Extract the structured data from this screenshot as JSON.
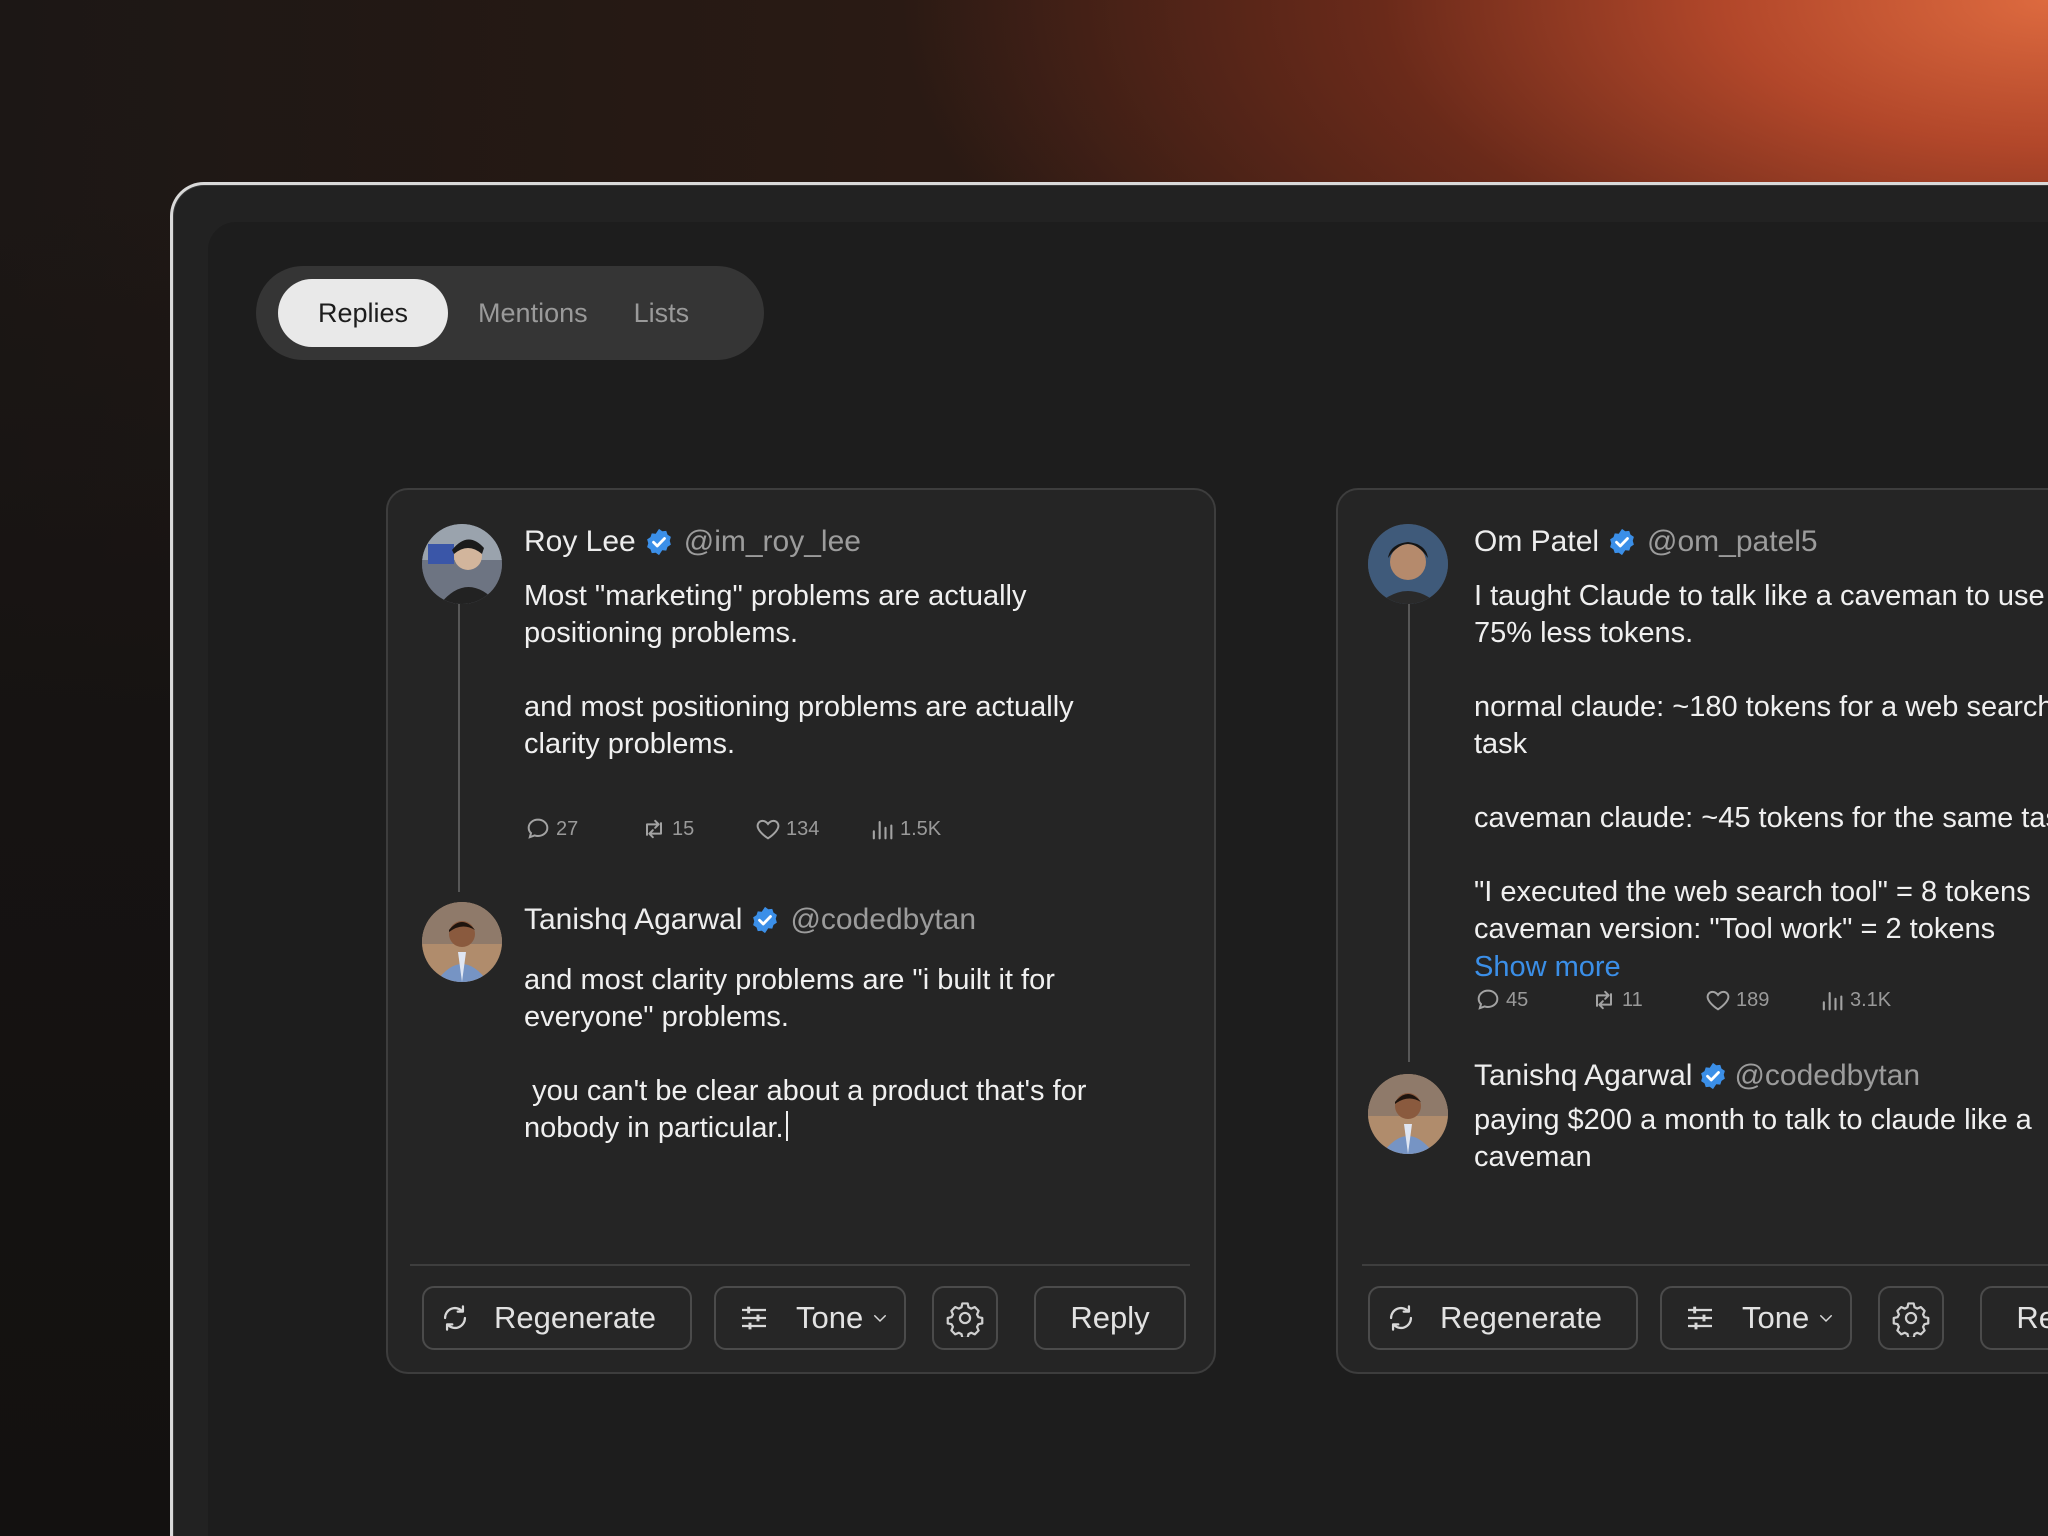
{
  "tabs": [
    "Replies",
    "Mentions",
    "Lists"
  ],
  "active_tab": "Replies",
  "cards": [
    {
      "original": {
        "name": "Roy Lee",
        "handle": "@im_roy_lee",
        "text": "Most \"marketing\" problems are actually\npositioning problems.\n\nand most positioning problems are actually\nclarity problems.",
        "stats": {
          "replies": "27",
          "reposts": "15",
          "likes": "134",
          "views": "1.5K"
        }
      },
      "reply": {
        "name": "Tanishq Agarwal",
        "handle": "@codedbytan",
        "text": "and most clarity problems are \"i built it for\neveryone\" problems.\n\n you can't be clear about a product that's for\nnobody in particular."
      },
      "actions": {
        "regenerate": "Regenerate",
        "tone": "Tone",
        "reply": "Reply"
      }
    },
    {
      "original": {
        "name": "Om Patel",
        "handle": "@om_patel5",
        "text": "I taught Claude to talk like a caveman to use\n75% less tokens.\n\nnormal claude: ~180 tokens for a web search\ntask\n\ncaveman claude: ~45 tokens for the same task\n\n\"I executed the web search tool\" = 8 tokens\ncaveman version: \"Tool work\" = 2 tokens",
        "show_more": "Show more",
        "stats": {
          "replies": "45",
          "reposts": "11",
          "likes": "189",
          "views": "3.1K"
        }
      },
      "reply": {
        "name": "Tanishq Agarwal",
        "handle": "@codedbytan",
        "text": "paying $200 a month to talk to claude like a\ncaveman"
      },
      "actions": {
        "regenerate": "Regenerate",
        "tone": "Tone",
        "reply": "Reply"
      }
    }
  ],
  "colors": {
    "accent": "#3b8fe8",
    "verified": "#3b8fe8"
  }
}
